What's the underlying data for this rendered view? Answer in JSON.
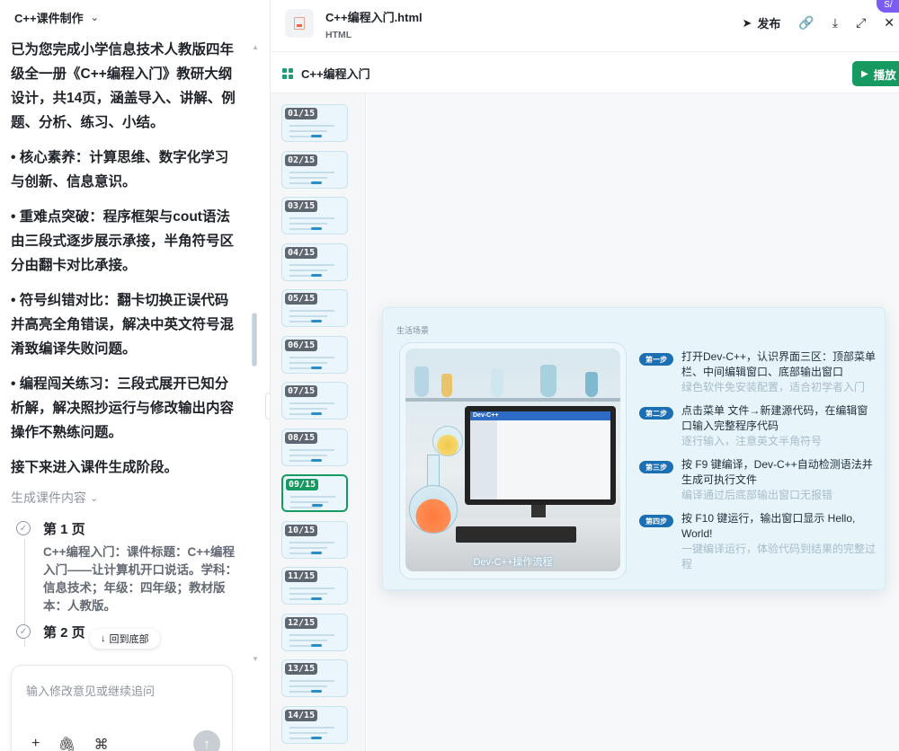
{
  "project": {
    "title": "C++课件制作"
  },
  "chat": {
    "paragraphs": [
      "已为您完成小学信息技术人教版四年级全一册《C++编程入门》教研大纲设计，共14页，涵盖导入、讲解、例题、分析、练习、小结。",
      "• 核心素养：计算思维、数字化学习与创新、信息意识。",
      "• 重难点突破：程序框架与cout语法由三段式逐步展示承接，半角符号区分由翻卡对比承接。",
      "• 符号纠错对比：翻卡切换正误代码并高亮全角错误，解决中英文符号混淆致编译失败问题。",
      "• 编程闯关练习：三段式展开已知分析解，解决照抄运行与修改输出内容操作不熟练问题。",
      "接下来进入课件生成阶段。"
    ],
    "gen_label": "生成课件内容",
    "pages": [
      {
        "title": "第 1 页",
        "desc": "C++编程入门：课件标题：C++编程入门——让计算机开口说话。学科：信息技术；年级：四年级；教材版本：人教版。"
      },
      {
        "title": "第 2 页",
        "desc": ""
      }
    ],
    "back_to_bottom": "回到底部",
    "input_placeholder": "输入修改意见或继续追问",
    "tools": [
      "+",
      "⌀",
      "⌘"
    ]
  },
  "file": {
    "name": "C++编程入门.html",
    "type": "HTML",
    "actions": {
      "publish": "发布"
    },
    "badge": "S/"
  },
  "deck": {
    "title": "C++编程入门",
    "play": "播放",
    "thumbnails": [
      "01/15",
      "02/15",
      "03/15",
      "04/15",
      "05/15",
      "06/15",
      "07/15",
      "08/15",
      "09/15",
      "10/15",
      "11/15",
      "12/15",
      "13/15",
      "14/15"
    ],
    "active_index": 8
  },
  "slide": {
    "tag": "生活场景",
    "caption": "Dev-C++操作流程",
    "screen_label": "Dev-C++",
    "steps": [
      {
        "badge": "第一步",
        "main": "打开Dev-C++，认识界面三区：顶部菜单栏、中间编辑窗口、底部输出窗口",
        "sub": "绿色软件免安装配置，适合初学者入门"
      },
      {
        "badge": "第二步",
        "main": "点击菜单 文件→新建源代码，在编辑窗口输入完整程序代码",
        "sub": "逐行输入，注意英文半角符号"
      },
      {
        "badge": "第三步",
        "main": "按 F9 键编译，Dev-C++自动检测语法并生成可执行文件",
        "sub": "编译通过后底部输出窗口无报错"
      },
      {
        "badge": "第四步",
        "main": "按 F10 键运行，输出窗口显示 Hello, World!",
        "sub": "一键编译运行，体验代码到结果的完整过程"
      }
    ]
  },
  "colors": {
    "accent_green": "#169a61",
    "step_badge": "#1d6fb3",
    "slide_bg": "#e7f5fb"
  }
}
